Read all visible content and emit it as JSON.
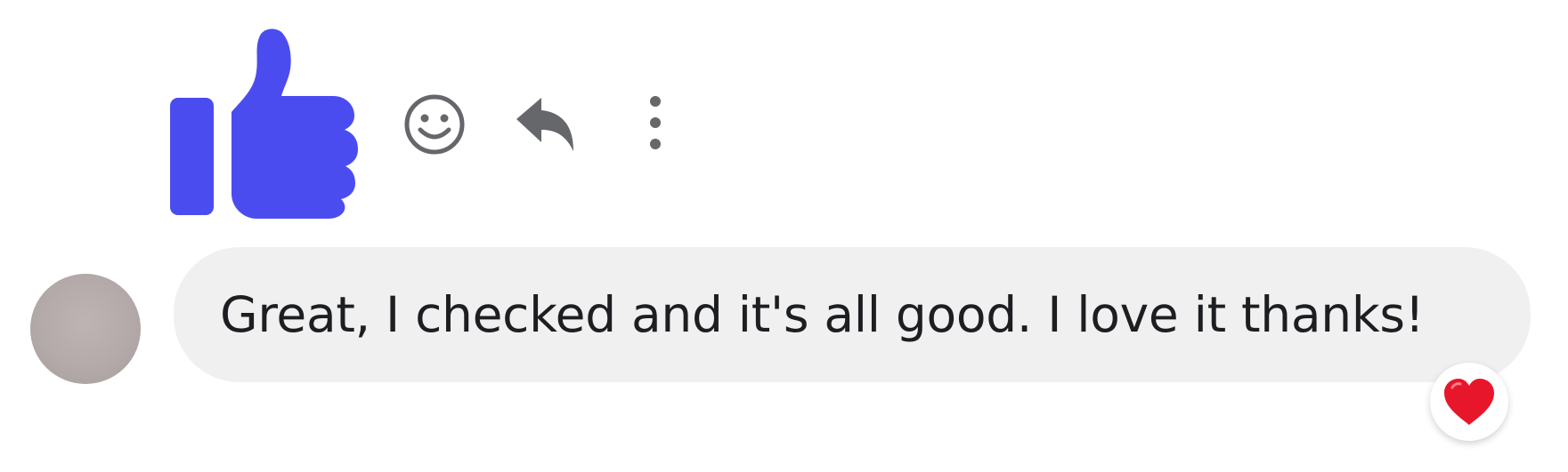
{
  "colors": {
    "like_icon": "#4b4cf0",
    "action_icon": "#65676b",
    "bubble_background": "#f0f0f0",
    "message_text": "#1c1e21",
    "heart": "#e8162b"
  },
  "toolbar": {
    "like_icon": "thumbs-up-icon",
    "react_icon": "smiley-face-icon",
    "reply_icon": "reply-arrow-icon",
    "more_icon": "vertical-ellipsis-icon"
  },
  "message": {
    "text": "Great, I checked and it's all good. I love it thanks!",
    "reaction_icon": "red-heart-icon"
  },
  "sender": {
    "avatar_icon": "blurred-avatar"
  }
}
